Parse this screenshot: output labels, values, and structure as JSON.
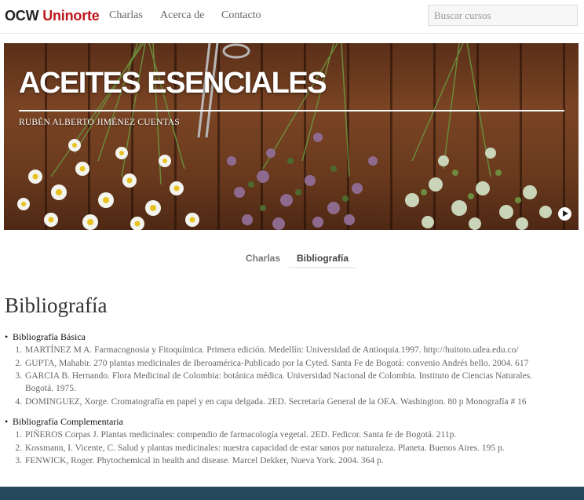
{
  "navbar": {
    "brand_part1": "OCW",
    "brand_part2": "Uninorte",
    "links": [
      "Charlas",
      "Acerca de",
      "Contacto"
    ],
    "search_placeholder": "Buscar cursos"
  },
  "hero": {
    "title": "ACEITES ESENCIALES",
    "author": "RUBÉN ALBERTO JIMÉNEZ CUENTAS"
  },
  "tabs": [
    {
      "label": "Charlas",
      "active": false
    },
    {
      "label": "Bibliografía",
      "active": true
    }
  ],
  "main": {
    "title": "Bibliografía",
    "sections": [
      {
        "heading": "Bibliografía Básica",
        "items": [
          {
            "num": "1.",
            "text": "MARTÍNEZ M A. Farmacognosia y Fitoquímica. Primera edición. Medellín: Universidad de Antioquia.1997. http://huitoto.udea.edu.co/"
          },
          {
            "num": "2.",
            "text": "GUPTA, Mahabir. 270 plantas medicinales de Iberoamérica-Publicado por la Cyted. Santa Fe de Bogotá: convenio Andrés bello. 2004. 617"
          },
          {
            "num": "3.",
            "text": "GARCIA B. Hernando. Flora Medicinal de Colombia: botánica médica. Universidad Nacional de Colombia. Instituto de Ciencias Naturales. Bogotá. 1975."
          },
          {
            "num": "4.",
            "text": "DOMINGUEZ, Xorge. Cromatografía en papel y en capa delgada. 2ED. Secretaría General de la OEA. Washington. 80 p Monografía # 16"
          }
        ]
      },
      {
        "heading": "Bibliografía Complementaria",
        "items": [
          {
            "num": "1.",
            "text": "PIÑEROS Corpas J. Plantas medicinales: compendio de farmacología vegetal. 2ED. Fedicor. Santa fe de Bogotá. 211p."
          },
          {
            "num": "2.",
            "text": "Kossmann, I. Vicente, C. Salud y plantas medicinales: nuestra capacidad de estar sanos por naturaleza. Planeta. Buenos Aires. 195 p."
          },
          {
            "num": "3.",
            "text": "FENWICK, Roger. Phytochemical in health and disease. Marcel Dekker, Nueva York. 2004. 364 p."
          }
        ]
      }
    ]
  },
  "colors": {
    "brand_accent": "#c0161b",
    "footer": "#24495a"
  }
}
